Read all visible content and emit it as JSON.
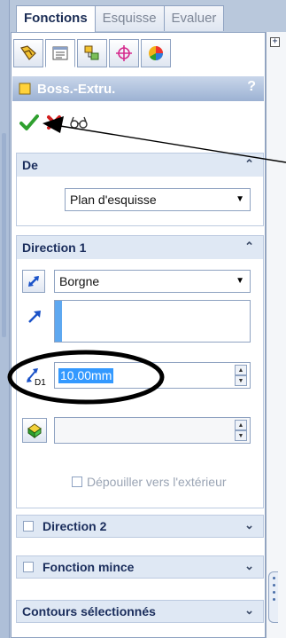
{
  "tabs": [
    {
      "label": "Fonctions",
      "active": true
    },
    {
      "label": "Esquisse",
      "active": false
    },
    {
      "label": "Evaluer",
      "active": false
    }
  ],
  "toolbar_icons": [
    "feature-manager-icon",
    "property-manager-icon",
    "configuration-manager-icon",
    "dimxpert-icon",
    "display-manager-icon"
  ],
  "feature": {
    "title": "Boss.-Extru.",
    "help": "?"
  },
  "groups": {
    "from": {
      "header": "De",
      "select_value": "Plan d'esquisse"
    },
    "direction1": {
      "header": "Direction 1",
      "end_condition": "Borgne",
      "depth_value": "10.00mm",
      "depth_label": "D1",
      "draft_outward": "Dépouiller vers l'extérieur"
    },
    "direction2": {
      "header": "Direction 2",
      "checked": false
    },
    "thin_feature": {
      "header": "Fonction mince",
      "checked": false
    },
    "selected_contours": {
      "header": "Contours sélectionnés"
    }
  },
  "right_panel": {
    "expand_symbol": "+"
  },
  "colors": {
    "accent_title": "#9cb2d3",
    "highlight": "#3399ff",
    "ok_green": "#2fa02f",
    "cancel_red": "#d21e1e"
  }
}
